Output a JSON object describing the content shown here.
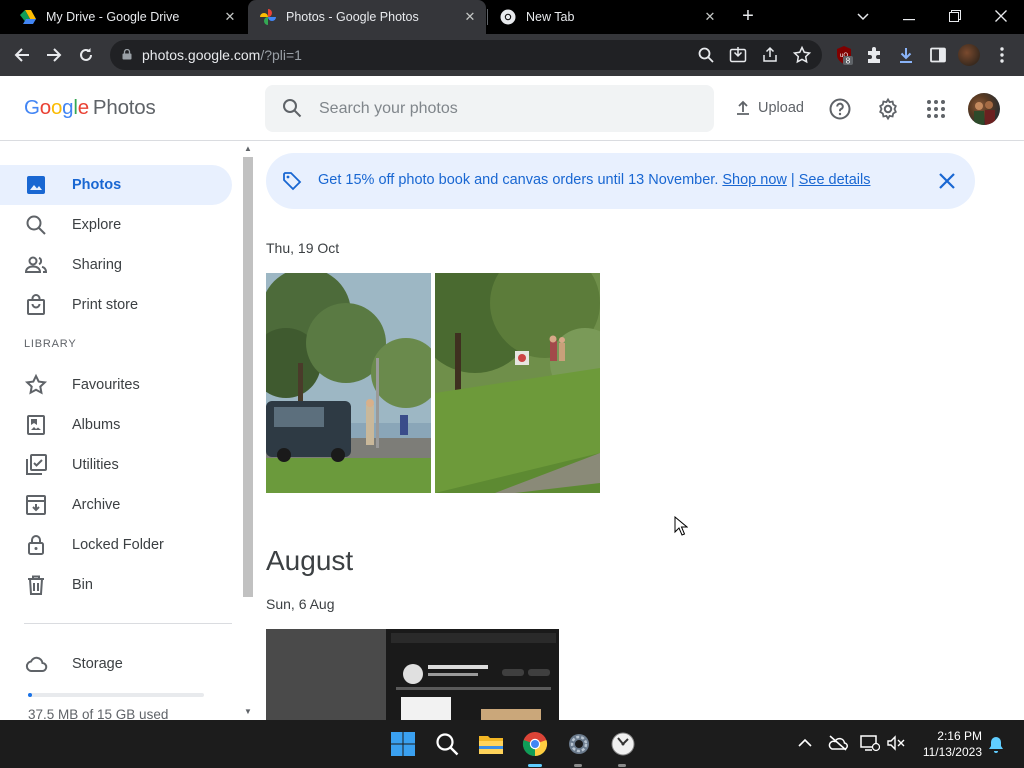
{
  "browser": {
    "tabs": [
      {
        "title": "My Drive - Google Drive",
        "icon": "google-drive-icon"
      },
      {
        "title": "Photos - Google Photos",
        "icon": "google-photos-icon",
        "active": true
      },
      {
        "title": "New Tab",
        "icon": "chrome-icon"
      }
    ],
    "close_glyph": "✕",
    "url_host": "photos.google.com",
    "url_path": "/?pli=1",
    "extension_badge": "8"
  },
  "header": {
    "logo_google": "Google",
    "logo_photos": "Photos",
    "search_placeholder": "Search your photos",
    "upload_label": "Upload"
  },
  "sidebar": {
    "items": [
      {
        "label": "Photos",
        "icon": "photo-icon",
        "active": true
      },
      {
        "label": "Explore",
        "icon": "search-icon"
      },
      {
        "label": "Sharing",
        "icon": "people-icon"
      },
      {
        "label": "Print store",
        "icon": "bag-icon"
      }
    ],
    "library_label": "LIBRARY",
    "library_items": [
      {
        "label": "Favourites",
        "icon": "star-icon"
      },
      {
        "label": "Albums",
        "icon": "album-icon"
      },
      {
        "label": "Utilities",
        "icon": "checklist-icon"
      },
      {
        "label": "Archive",
        "icon": "archive-icon"
      },
      {
        "label": "Locked Folder",
        "icon": "lock-icon"
      },
      {
        "label": "Bin",
        "icon": "trash-icon"
      }
    ],
    "storage_label": "Storage",
    "storage_used": "37.5 MB of 15 GB used",
    "storage_fraction": 0.0025
  },
  "banner": {
    "text": "Get 15% off photo book and canvas orders until 13 November.",
    "shop_link": "Shop now",
    "divider": "|",
    "details_link": "See details"
  },
  "timeline": {
    "group1_date": "Thu, 19 Oct",
    "month_heading": "August",
    "group2_date": "Sun, 6 Aug"
  },
  "taskbar": {
    "time": "2:16 PM",
    "date": "11/13/2023"
  },
  "colors": {
    "accent": "#1a73e8",
    "active_nav_bg": "#e8f0fe",
    "active_nav_text": "#1967d2"
  }
}
